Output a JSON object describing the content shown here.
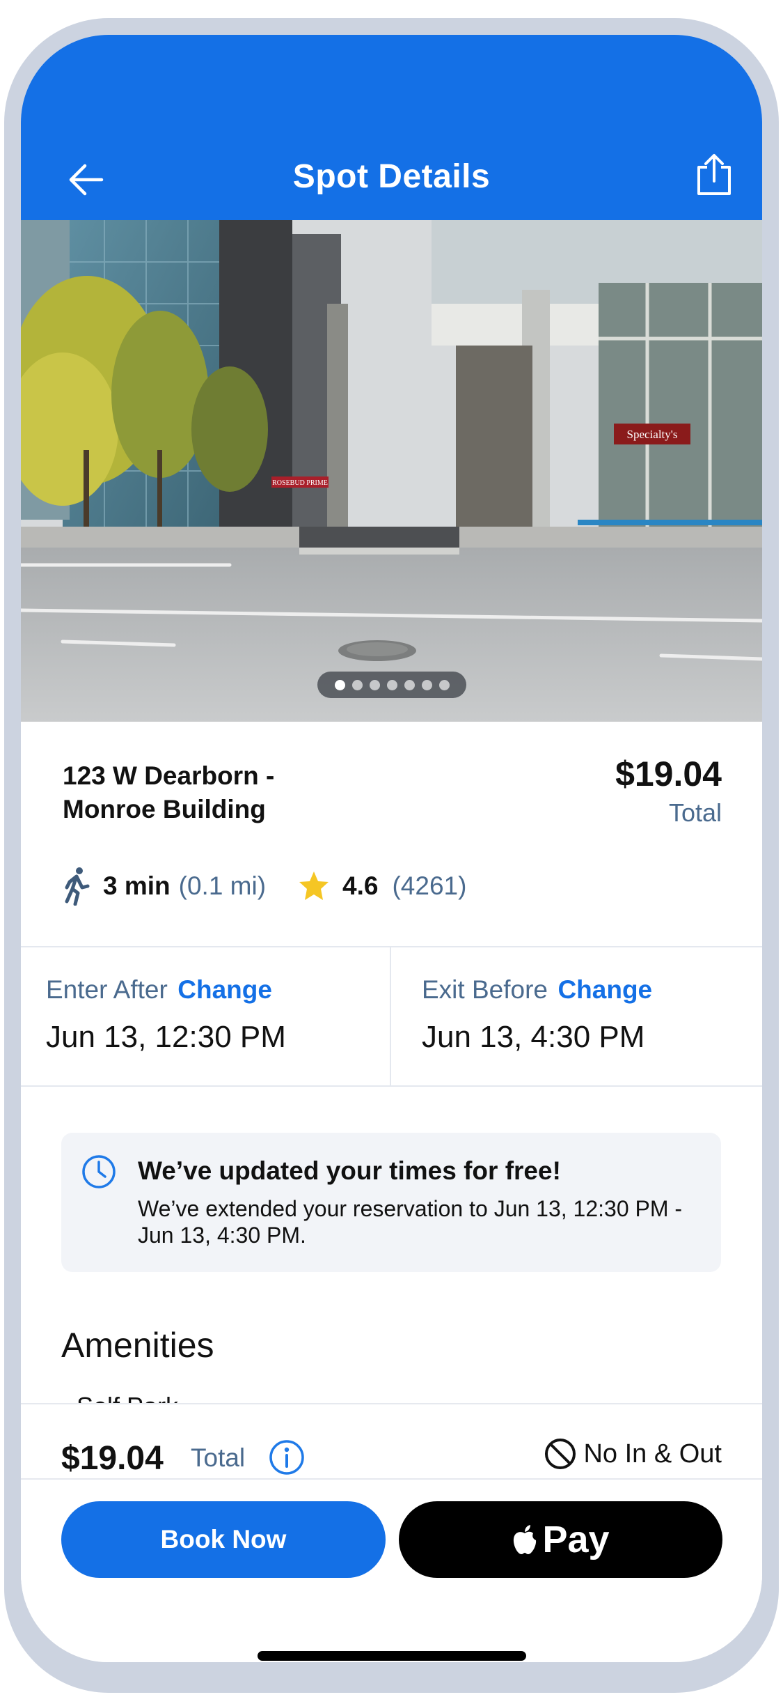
{
  "header": {
    "title": "Spot Details",
    "back_icon": "arrow-left-icon",
    "share_icon": "share-icon",
    "color": "#1470e6"
  },
  "gallery": {
    "page_count": 7,
    "active_page": 1,
    "signs": [
      "ROSEBUD PRIME",
      "Specialty's"
    ]
  },
  "spot": {
    "name": "123 W Dearborn - Monroe Building",
    "price": "$19.04",
    "price_label": "Total",
    "walk_time": "3 min",
    "walk_distance": "(0.1 mi)",
    "rating": "4.6",
    "review_count": "(4261)"
  },
  "times": {
    "enter_label": "Enter After",
    "enter_change": "Change",
    "enter_value": "Jun 13, 12:30 PM",
    "exit_label": "Exit Before",
    "exit_change": "Change",
    "exit_value": "Jun 13, 4:30 PM"
  },
  "notice": {
    "title": "We’ve updated your times for free!",
    "body": "We’ve extended your reservation to Jun 13, 12:30 PM - Jun 13, 4:30 PM."
  },
  "amenities": {
    "title": "Amenities",
    "first_item": "Self Park"
  },
  "bottom_bar": {
    "price": "$19.04",
    "price_label": "Total",
    "restriction": "No In & Out",
    "book_button": "Book Now",
    "apple_pay_label": "Pay"
  }
}
